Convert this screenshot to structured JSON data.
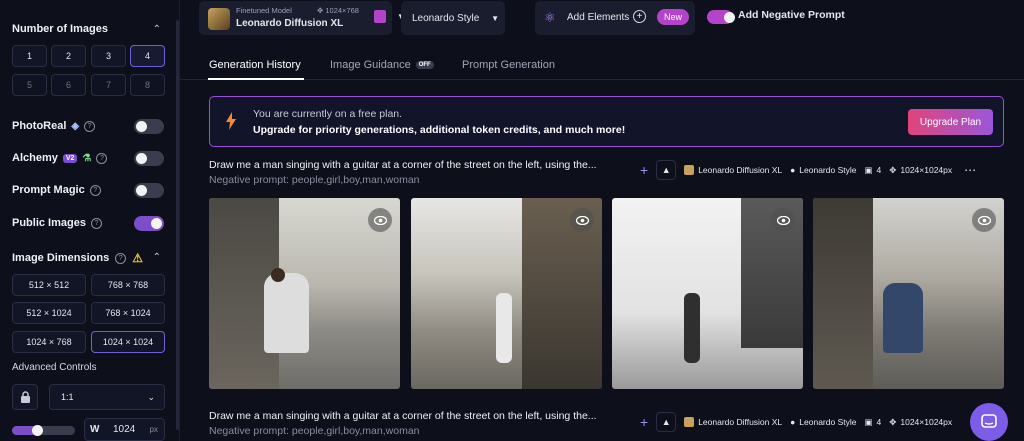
{
  "sidebar": {
    "num_images_title": "Number of Images",
    "num_options": [
      "1",
      "2",
      "3",
      "4",
      "5",
      "6",
      "7",
      "8"
    ],
    "selected_num": "4",
    "photoreal_label": "PhotoReal",
    "alchemy_label": "Alchemy",
    "alchemy_badge": "V2",
    "prompt_magic_label": "Prompt Magic",
    "public_images_label": "Public Images",
    "dimensions_title": "Image Dimensions",
    "dim_options": [
      "512 × 512",
      "768 × 768",
      "512 × 1024",
      "768 × 1024",
      "1024 × 768",
      "1024 × 1024"
    ],
    "selected_dim": "1024 × 1024",
    "advanced_label": "Advanced Controls",
    "ratio_value": "1:1",
    "width_label": "W",
    "width_value": "1024",
    "width_unit": "px",
    "slider_level": 0.4
  },
  "topbar": {
    "model_caption": "Finetuned Model",
    "model_size": "1024×768",
    "model_name": "Leonardo Diffusion XL",
    "style_label": "Leonardo Style",
    "add_elements_label": "Add Elements",
    "new_badge": "New",
    "neg_prompt_label": "Add Negative Prompt"
  },
  "tabs": {
    "history": "Generation History",
    "guidance": "Image Guidance",
    "guidance_badge": "OFF",
    "prompt_gen": "Prompt Generation"
  },
  "banner": {
    "line1": "You are currently on a free plan.",
    "line2": "Upgrade for priority generations, additional token credits, and much more!",
    "button": "Upgrade Plan"
  },
  "generations": [
    {
      "prompt": "Draw me a man singing with a guitar at a corner of the street on the left, using the...",
      "negative": "Negative prompt: people,girl,boy,man,woman",
      "model": "Leonardo Diffusion XL",
      "style": "Leonardo Style",
      "count": "4",
      "size": "1024×1024px"
    },
    {
      "prompt": "Draw me a man singing with a guitar at a corner of the street on the left, using the...",
      "negative": "Negative prompt: people,girl,boy,man,woman",
      "model": "Leonardo Diffusion XL",
      "style": "Leonardo Style",
      "count": "4",
      "size": "1024×1024px"
    }
  ],
  "colors": {
    "accent": "#7b4fc9",
    "banner_border": "#9a4fd9",
    "background": "#0d0f1a"
  }
}
